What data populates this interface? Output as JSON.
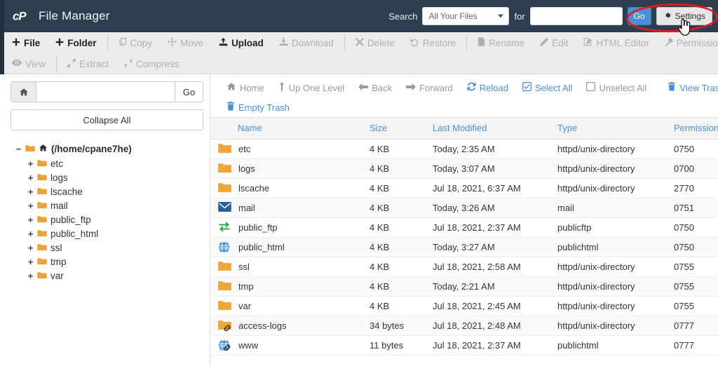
{
  "header": {
    "logo": "cpanel-logo",
    "title": "File Manager",
    "search_label": "Search",
    "search_scope": "All Your Files",
    "search_for_label": "for",
    "search_value": "",
    "search_placeholder": "",
    "go_label": "Go",
    "settings_label": "Settings",
    "settings_icon": "gear-icon"
  },
  "toolbar": {
    "row1": [
      {
        "label": "File",
        "icon": "plus-icon",
        "enabled": true
      },
      {
        "label": "Folder",
        "icon": "plus-icon",
        "enabled": true
      },
      {
        "label": "Copy",
        "icon": "copy-icon",
        "enabled": false
      },
      {
        "label": "Move",
        "icon": "move-icon",
        "enabled": false
      },
      {
        "label": "Upload",
        "icon": "upload-icon",
        "enabled": true
      },
      {
        "label": "Download",
        "icon": "download-icon",
        "enabled": false
      },
      {
        "label": "Delete",
        "icon": "times-icon",
        "enabled": false
      },
      {
        "label": "Restore",
        "icon": "undo-icon",
        "enabled": false
      },
      {
        "label": "Rename",
        "icon": "file-icon",
        "enabled": false
      },
      {
        "label": "Edit",
        "icon": "pencil-icon",
        "enabled": false
      },
      {
        "label": "HTML Editor",
        "icon": "edit-square-icon",
        "enabled": false
      },
      {
        "label": "Permissions",
        "icon": "key-icon",
        "enabled": false
      }
    ],
    "row2": [
      {
        "label": "View",
        "icon": "eye-icon",
        "enabled": false
      },
      {
        "label": "Extract",
        "icon": "expand-icon",
        "enabled": false
      },
      {
        "label": "Compress",
        "icon": "compress-icon",
        "enabled": false
      }
    ]
  },
  "sidebar": {
    "home_icon": "home-icon",
    "path_value": "",
    "path_placeholder": "",
    "go_label": "Go",
    "collapse_label": "Collapse All",
    "root_label": "(/home/cpane7he)",
    "root_toggle": "−",
    "nodes": [
      {
        "label": "etc",
        "toggle": "+"
      },
      {
        "label": "logs",
        "toggle": "+"
      },
      {
        "label": "lscache",
        "toggle": "+"
      },
      {
        "label": "mail",
        "toggle": "+"
      },
      {
        "label": "public_ftp",
        "toggle": "+"
      },
      {
        "label": "public_html",
        "toggle": "+"
      },
      {
        "label": "ssl",
        "toggle": "+"
      },
      {
        "label": "tmp",
        "toggle": "+"
      },
      {
        "label": "var",
        "toggle": "+"
      }
    ]
  },
  "nav": {
    "row1": [
      {
        "label": "Home",
        "icon": "home-icon",
        "enabled": false
      },
      {
        "label": "Up One Level",
        "icon": "level-up-icon",
        "enabled": false
      },
      {
        "label": "Back",
        "icon": "arrow-left-icon",
        "enabled": false
      },
      {
        "label": "Forward",
        "icon": "arrow-right-icon",
        "enabled": false
      },
      {
        "label": "Reload",
        "icon": "refresh-icon",
        "enabled": true
      },
      {
        "label": "Select All",
        "icon": "checkbox-checked-icon",
        "enabled": true
      },
      {
        "label": "Unselect All",
        "icon": "checkbox-empty-icon",
        "enabled": false
      }
    ],
    "row1_right": [
      {
        "label": "View Trash",
        "icon": "trash-icon",
        "enabled": true
      }
    ],
    "row2": [
      {
        "label": "Empty Trash",
        "icon": "trash-icon",
        "enabled": true
      }
    ]
  },
  "table": {
    "columns": [
      "Name",
      "Size",
      "Last Modified",
      "Type",
      "Permissions"
    ],
    "rows": [
      {
        "icon": "folder-icon",
        "name": "etc",
        "size": "4 KB",
        "modified": "Today, 2:35 AM",
        "type": "httpd/unix-directory",
        "permissions": "0750"
      },
      {
        "icon": "folder-icon",
        "name": "logs",
        "size": "4 KB",
        "modified": "Today, 3:07 AM",
        "type": "httpd/unix-directory",
        "permissions": "0700"
      },
      {
        "icon": "folder-icon",
        "name": "lscache",
        "size": "4 KB",
        "modified": "Jul 18, 2021, 6:37 AM",
        "type": "httpd/unix-directory",
        "permissions": "2770"
      },
      {
        "icon": "mail-icon",
        "name": "mail",
        "size": "4 KB",
        "modified": "Today, 3:26 AM",
        "type": "mail",
        "permissions": "0751"
      },
      {
        "icon": "ftp-icon",
        "name": "public_ftp",
        "size": "4 KB",
        "modified": "Jul 18, 2021, 2:37 AM",
        "type": "publicftp",
        "permissions": "0750"
      },
      {
        "icon": "globe-icon",
        "name": "public_html",
        "size": "4 KB",
        "modified": "Today, 3:27 AM",
        "type": "publichtml",
        "permissions": "0750"
      },
      {
        "icon": "folder-icon",
        "name": "ssl",
        "size": "4 KB",
        "modified": "Jul 18, 2021, 2:58 AM",
        "type": "httpd/unix-directory",
        "permissions": "0755"
      },
      {
        "icon": "folder-icon",
        "name": "tmp",
        "size": "4 KB",
        "modified": "Today, 2:21 AM",
        "type": "httpd/unix-directory",
        "permissions": "0755"
      },
      {
        "icon": "folder-icon",
        "name": "var",
        "size": "4 KB",
        "modified": "Jul 18, 2021, 2:45 AM",
        "type": "httpd/unix-directory",
        "permissions": "0755"
      },
      {
        "icon": "folder-link-icon",
        "name": "access-logs",
        "size": "34 bytes",
        "modified": "Jul 18, 2021, 2:48 AM",
        "type": "httpd/unix-directory",
        "permissions": "0777"
      },
      {
        "icon": "globe-link-icon",
        "name": "www",
        "size": "11 bytes",
        "modified": "Jul 18, 2021, 2:37 AM",
        "type": "publichtml",
        "permissions": "0777"
      }
    ]
  },
  "annotation": {
    "shape": "red-ellipse-highlight",
    "color": "#e01b1b",
    "cursor": "pointing-hand-cursor"
  },
  "colors": {
    "header_bg": "#2c3e50",
    "accent_blue": "#4a90d9",
    "folder_orange": "#e8a33d",
    "toolbar_bg": "#ececec",
    "annotation_red": "#e01b1b"
  }
}
